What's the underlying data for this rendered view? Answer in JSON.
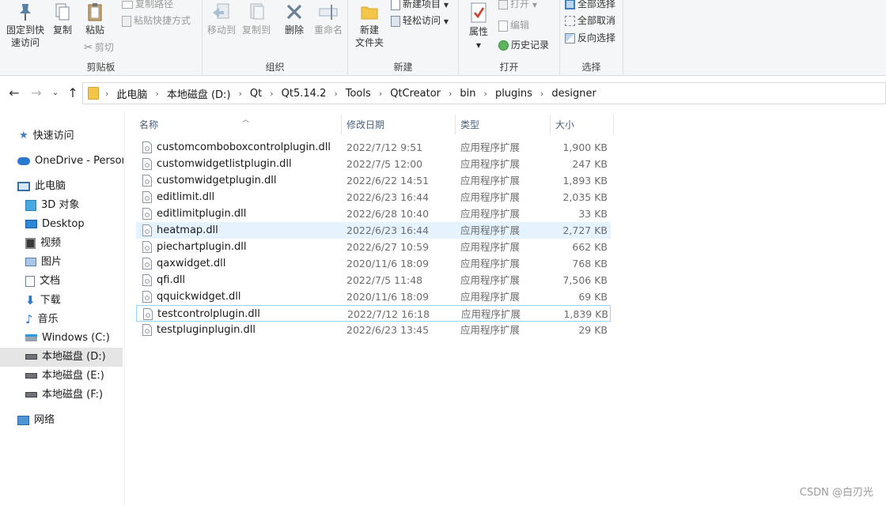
{
  "ribbon": {
    "clipboard": {
      "label": "剪贴板",
      "pin": "固定到快速访问",
      "pin_line1": "固定到快",
      "pin_line2": "速访问",
      "copy": "复制",
      "paste": "粘贴",
      "copy_path": "复制路径",
      "paste_shortcut": "粘贴快捷方式",
      "cut": "剪切"
    },
    "organize": {
      "label": "组织",
      "move_to": "移动到",
      "copy_to": "复制到",
      "delete": "删除",
      "rename": "重命名"
    },
    "new": {
      "label": "新建",
      "new_folder_line1": "新建",
      "new_folder_line2": "文件夹",
      "new_item": "新建项目",
      "easy_access": "轻松访问"
    },
    "open": {
      "label": "打开",
      "properties": "属性",
      "open": "打开",
      "edit": "编辑",
      "history": "历史记录"
    },
    "select": {
      "label": "选择",
      "select_all": "全部选择",
      "select_none": "全部取消",
      "invert": "反向选择"
    }
  },
  "address": {
    "crumbs": [
      "此电脑",
      "本地磁盘 (D:)",
      "Qt",
      "Qt5.14.2",
      "Tools",
      "QtCreator",
      "bin",
      "plugins",
      "designer"
    ]
  },
  "sidebar": {
    "items": [
      {
        "label": "快速访问",
        "icon": "star-icon"
      },
      {
        "label": "OneDrive - Personal",
        "icon": "cloud-icon"
      },
      {
        "label": "此电脑",
        "icon": "computer-icon"
      },
      {
        "label": "3D 对象",
        "icon": "cube-icon"
      },
      {
        "label": "Desktop",
        "icon": "desktop-icon"
      },
      {
        "label": "视频",
        "icon": "video-icon"
      },
      {
        "label": "图片",
        "icon": "picture-icon"
      },
      {
        "label": "文档",
        "icon": "document-icon"
      },
      {
        "label": "下载",
        "icon": "download-icon"
      },
      {
        "label": "音乐",
        "icon": "music-icon"
      },
      {
        "label": "Windows (C:)",
        "icon": "drive-windows-icon"
      },
      {
        "label": "本地磁盘 (D:)",
        "icon": "drive-icon"
      },
      {
        "label": "本地磁盘 (E:)",
        "icon": "drive-icon"
      },
      {
        "label": "本地磁盘 (F:)",
        "icon": "drive-icon"
      },
      {
        "label": "网络",
        "icon": "network-icon"
      }
    ]
  },
  "list": {
    "headers": {
      "name": "名称",
      "date": "修改日期",
      "type": "类型",
      "size": "大小"
    },
    "rows": [
      {
        "name": "customcomboboxcontrolplugin.dll",
        "date": "2022/7/12 9:51",
        "type": "应用程序扩展",
        "size": "1,900 KB"
      },
      {
        "name": "customwidgetlistplugin.dll",
        "date": "2022/7/5 12:00",
        "type": "应用程序扩展",
        "size": "247 KB"
      },
      {
        "name": "customwidgetplugin.dll",
        "date": "2022/6/22 14:51",
        "type": "应用程序扩展",
        "size": "1,893 KB"
      },
      {
        "name": "editlimit.dll",
        "date": "2022/6/23 16:44",
        "type": "应用程序扩展",
        "size": "2,035 KB"
      },
      {
        "name": "editlimitplugin.dll",
        "date": "2022/6/28 10:40",
        "type": "应用程序扩展",
        "size": "33 KB"
      },
      {
        "name": "heatmap.dll",
        "date": "2022/6/23 16:44",
        "type": "应用程序扩展",
        "size": "2,727 KB"
      },
      {
        "name": "piechartplugin.dll",
        "date": "2022/6/27 10:59",
        "type": "应用程序扩展",
        "size": "662 KB"
      },
      {
        "name": "qaxwidget.dll",
        "date": "2020/11/6 18:09",
        "type": "应用程序扩展",
        "size": "768 KB"
      },
      {
        "name": "qfi.dll",
        "date": "2022/7/5 11:48",
        "type": "应用程序扩展",
        "size": "7,506 KB"
      },
      {
        "name": "qquickwidget.dll",
        "date": "2020/11/6 18:09",
        "type": "应用程序扩展",
        "size": "69 KB"
      },
      {
        "name": "testcontrolplugin.dll",
        "date": "2022/7/12 16:18",
        "type": "应用程序扩展",
        "size": "1,839 KB"
      },
      {
        "name": "testpluginplugin.dll",
        "date": "2022/6/23 13:45",
        "type": "应用程序扩展",
        "size": "29 KB"
      }
    ]
  },
  "watermark": "CSDN @白刃光"
}
